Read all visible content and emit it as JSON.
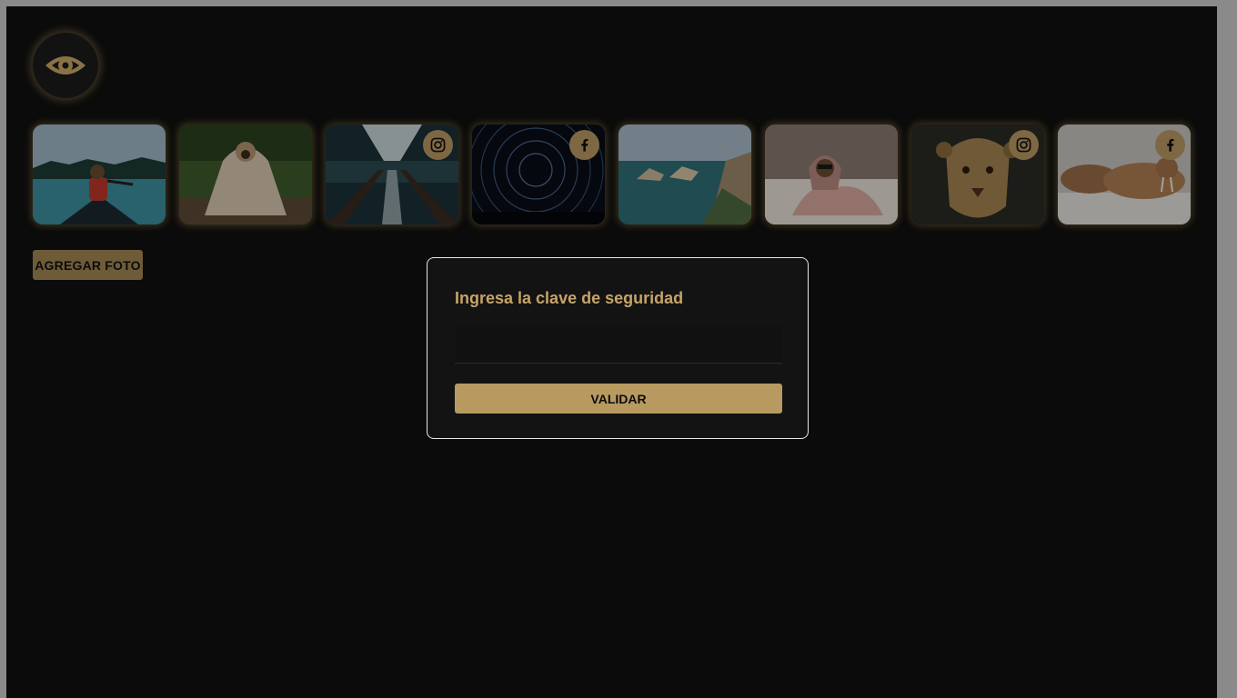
{
  "logo": {
    "icon": "eye-icon",
    "accent": "#b89a60"
  },
  "gallery": {
    "photos": [
      {
        "subject": "woman paddling canoe on lake",
        "badge": null
      },
      {
        "subject": "pug wrapped in blanket in forest",
        "badge": null
      },
      {
        "subject": "train station escalators",
        "badge": "instagram-icon"
      },
      {
        "subject": "star trails night sky",
        "badge": "facebook-icon"
      },
      {
        "subject": "coastal cliffs and sea",
        "badge": null
      },
      {
        "subject": "pug in blanket on bed",
        "badge": null
      },
      {
        "subject": "lioness portrait",
        "badge": "instagram-icon"
      },
      {
        "subject": "walruses on beach",
        "badge": "facebook-icon"
      }
    ]
  },
  "actions": {
    "add_photo_label": "AGREGAR FOTO"
  },
  "modal": {
    "title": "Ingresa la clave de seguridad",
    "input_value": "",
    "input_placeholder": "",
    "validate_label": "VALIDAR"
  },
  "colors": {
    "background": "#0b0b0b",
    "accent": "#b89a60",
    "dim_accent": "#6e5b38",
    "modal_bg": "#131313"
  }
}
